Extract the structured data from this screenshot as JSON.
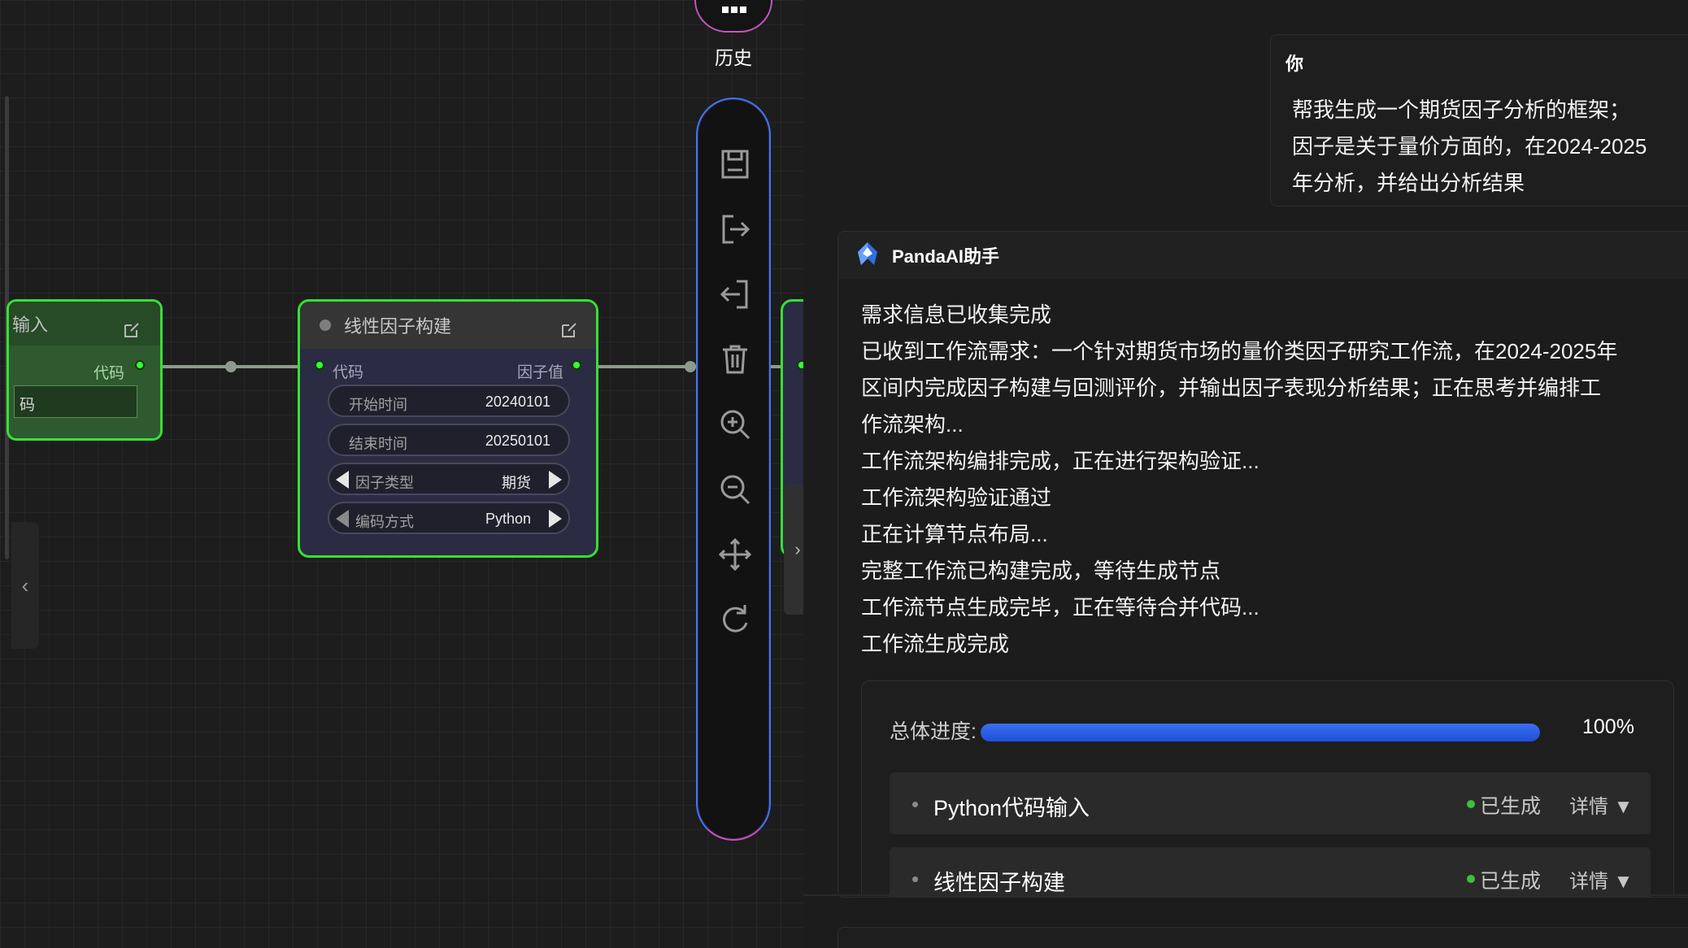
{
  "toolbar": {
    "history_label": "历史",
    "tools": [
      "save-icon",
      "export-icon",
      "import-icon",
      "delete-icon",
      "zoom-in-icon",
      "zoom-out-icon",
      "move-icon",
      "refresh-icon"
    ]
  },
  "nodes": {
    "python_input": {
      "title": "输入",
      "output_label": "代码",
      "code_value": "码"
    },
    "linear_factor": {
      "title": "线性因子构建",
      "input_label": "代码",
      "output_label": "因子值",
      "start_label": "开始时间",
      "start_value": "20240101",
      "end_label": "结束时间",
      "end_value": "20250101",
      "factor_type_label": "因子类型",
      "factor_type_value": "期货",
      "encoding_label": "编码方式",
      "encoding_value": "Python"
    }
  },
  "chat": {
    "user": {
      "name": "你",
      "lines": [
        "帮我生成一个期货因子分析的框架；",
        "因子是关于量价方面的，在2024-2025",
        "年分析，并给出分析结果"
      ]
    },
    "assistant": {
      "name": "PandaAI助手",
      "lines": [
        "需求信息已收集完成",
        "已收到工作流需求：一个针对期货市场的量价类因子研究工作流，在2024-2025年",
        "区间内完成因子构建与回测评价，并输出因子表现分析结果；正在思考并编排工",
        "作流架构...",
        "工作流架构编排完成，正在进行架构验证...",
        "工作流架构验证通过",
        "正在计算节点布局...",
        "完整工作流已构建完成，等待生成节点",
        "工作流节点生成完毕，正在等待合并代码...",
        "工作流生成完成"
      ]
    },
    "progress": {
      "label": "总体进度:",
      "percent_text": "100%",
      "fraction": 1.0,
      "steps": [
        {
          "name": "Python代码输入",
          "status": "已生成",
          "details": "详情 ▼"
        },
        {
          "name": "线性因子构建",
          "status": "已生成",
          "details": "详情 ▼"
        }
      ]
    }
  },
  "colors": {
    "node_border": "#36e036",
    "toolbar_top": "#3a78ff",
    "toolbar_bottom": "#c455c4",
    "progress": "#2f62ea",
    "status_ok": "#3fbf3f"
  }
}
